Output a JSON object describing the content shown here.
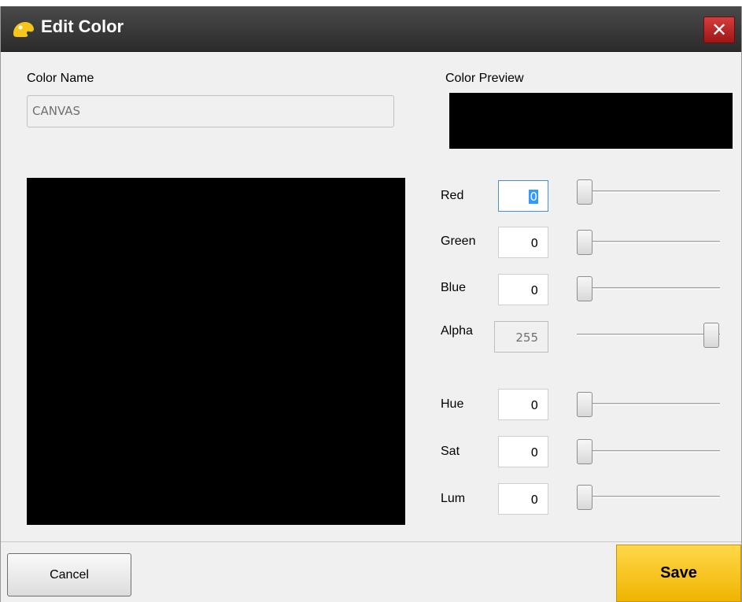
{
  "window": {
    "title": "Edit Color",
    "close_glyph": "✕",
    "icon": "color-palette-icon"
  },
  "color_name": {
    "label": "Color Name",
    "value": "CANVAS"
  },
  "color_preview": {
    "label": "Color Preview",
    "color": "#000000"
  },
  "canvas_color": "#000000",
  "channels": [
    {
      "label": "Red",
      "value": "0",
      "level": 0,
      "enabled": true
    },
    {
      "label": "Green",
      "value": "0",
      "level": 0,
      "enabled": true
    },
    {
      "label": "Blue",
      "value": "0",
      "level": 0,
      "enabled": true
    },
    {
      "label": "Alpha",
      "value": "255",
      "level": 1,
      "enabled": false
    },
    {
      "label": "Hue",
      "value": "0",
      "level": 0,
      "enabled": true
    },
    {
      "label": "Sat",
      "value": "0",
      "level": 0,
      "enabled": true
    },
    {
      "label": "Lum",
      "value": "0",
      "level": 0,
      "enabled": true
    }
  ],
  "buttons": {
    "cancel": "Cancel",
    "save": "Save"
  },
  "colors": {
    "titlebar": "#2b2b2b",
    "save_accent": "#f5c518",
    "close_red": "#c32a2a"
  }
}
